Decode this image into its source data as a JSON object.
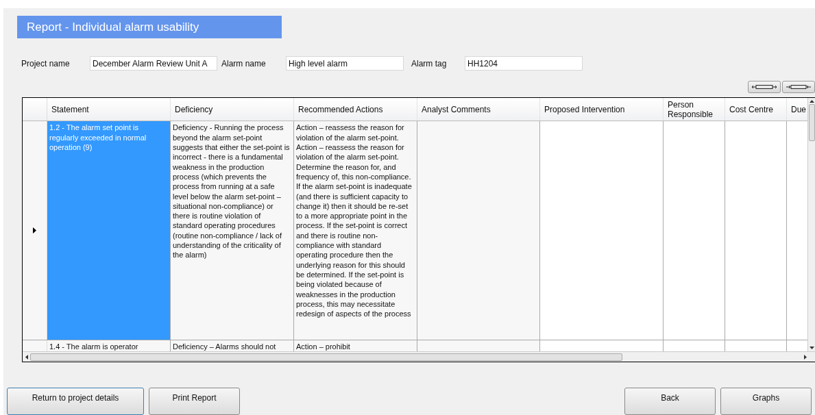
{
  "title": "Report - Individual alarm usability",
  "fields": [
    {
      "label": "Project name",
      "value": "December Alarm Review Unit A"
    },
    {
      "label": "Alarm name",
      "value": "High level alarm"
    },
    {
      "label": "Alarm tag",
      "value": "HH1204"
    }
  ],
  "table": {
    "columns": [
      "Statement",
      "Deficiency",
      "Recommended Actions",
      "Analyst Comments",
      "Proposed Intervention",
      "Person Responsible",
      "Cost Centre",
      "Due"
    ],
    "rows": [
      {
        "selected": true,
        "current": true,
        "cells": [
          "1.2 - The alarm set point is regularly exceeded in normal operation (9)",
          "Deficiency - Running the process beyond the alarm set-point suggests that either the set-point is incorrect - there is a fundamental weakness in the production process (which prevents the process from running at a safe level below the alarm set-point – situational non-compliance) or there is routine violation of standard operating procedures (routine non-compliance / lack of understanding of the criticality of the alarm)",
          "Action – reassess the reason for violation of the alarm set-point. Action – reassess the reason for violation of the alarm set-point. Determine the reason for, and frequency of, this non-compliance. If the alarm set-point is inadequate (and there is sufficient capacity to change it) then it should be re-set to a more appropriate point in the process. If the set-point is correct and there is routine non-compliance with standard operating procedure then the underlying reason for this should be determined. If the set-point is being violated because of weaknesses in the production process, this may necessitate redesign of aspects of the process",
          "",
          "",
          "",
          "",
          ""
        ]
      },
      {
        "selected": false,
        "current": false,
        "cells": [
          "1.4 - The alarm is operator",
          "Deficiency – Alarms should not",
          "Action – prohibit",
          "",
          "",
          "",
          "",
          ""
        ]
      }
    ]
  },
  "left_buttons": [
    "Return to project details",
    "Print Report"
  ],
  "right_buttons": [
    "Back",
    "Graphs"
  ]
}
